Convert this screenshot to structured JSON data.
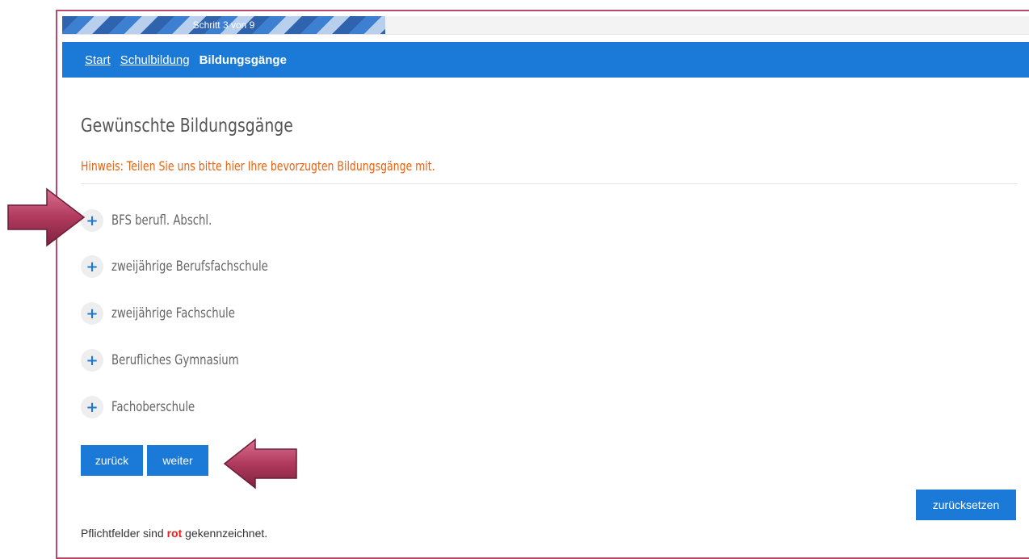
{
  "progress": {
    "label": "Schritt 3 von 9",
    "fraction": 0.3333
  },
  "breadcrumb": {
    "start": "Start",
    "schulbildung": "Schulbildung",
    "current": "Bildungsgänge"
  },
  "page": {
    "title": "Gewünschte Bildungsgänge",
    "hint": "Hinweis: Teilen Sie uns bitte hier Ihre bevorzugten Bildungsgänge mit."
  },
  "items": [
    {
      "icon": "plus-icon",
      "label": "BFS berufl. Abschl."
    },
    {
      "icon": "plus-icon",
      "label": "zweijährige Berufsfachschule"
    },
    {
      "icon": "plus-icon",
      "label": "zweijährige Fachschule"
    },
    {
      "icon": "plus-icon",
      "label": "Berufliches Gymnasium"
    },
    {
      "icon": "plus-icon",
      "label": "Fachoberschule"
    }
  ],
  "buttons": {
    "back": "zurück",
    "next": "weiter",
    "reset": "zurücksetzen"
  },
  "footer": {
    "prefix": "Pflichtfelder sind ",
    "highlight": "rot",
    "suffix": " gekennzeichnet."
  },
  "colors": {
    "accent": "#1b7ad7",
    "hint": "#e8620e",
    "frame": "#b8496a",
    "annotation_arrow": "#b03a5e"
  }
}
